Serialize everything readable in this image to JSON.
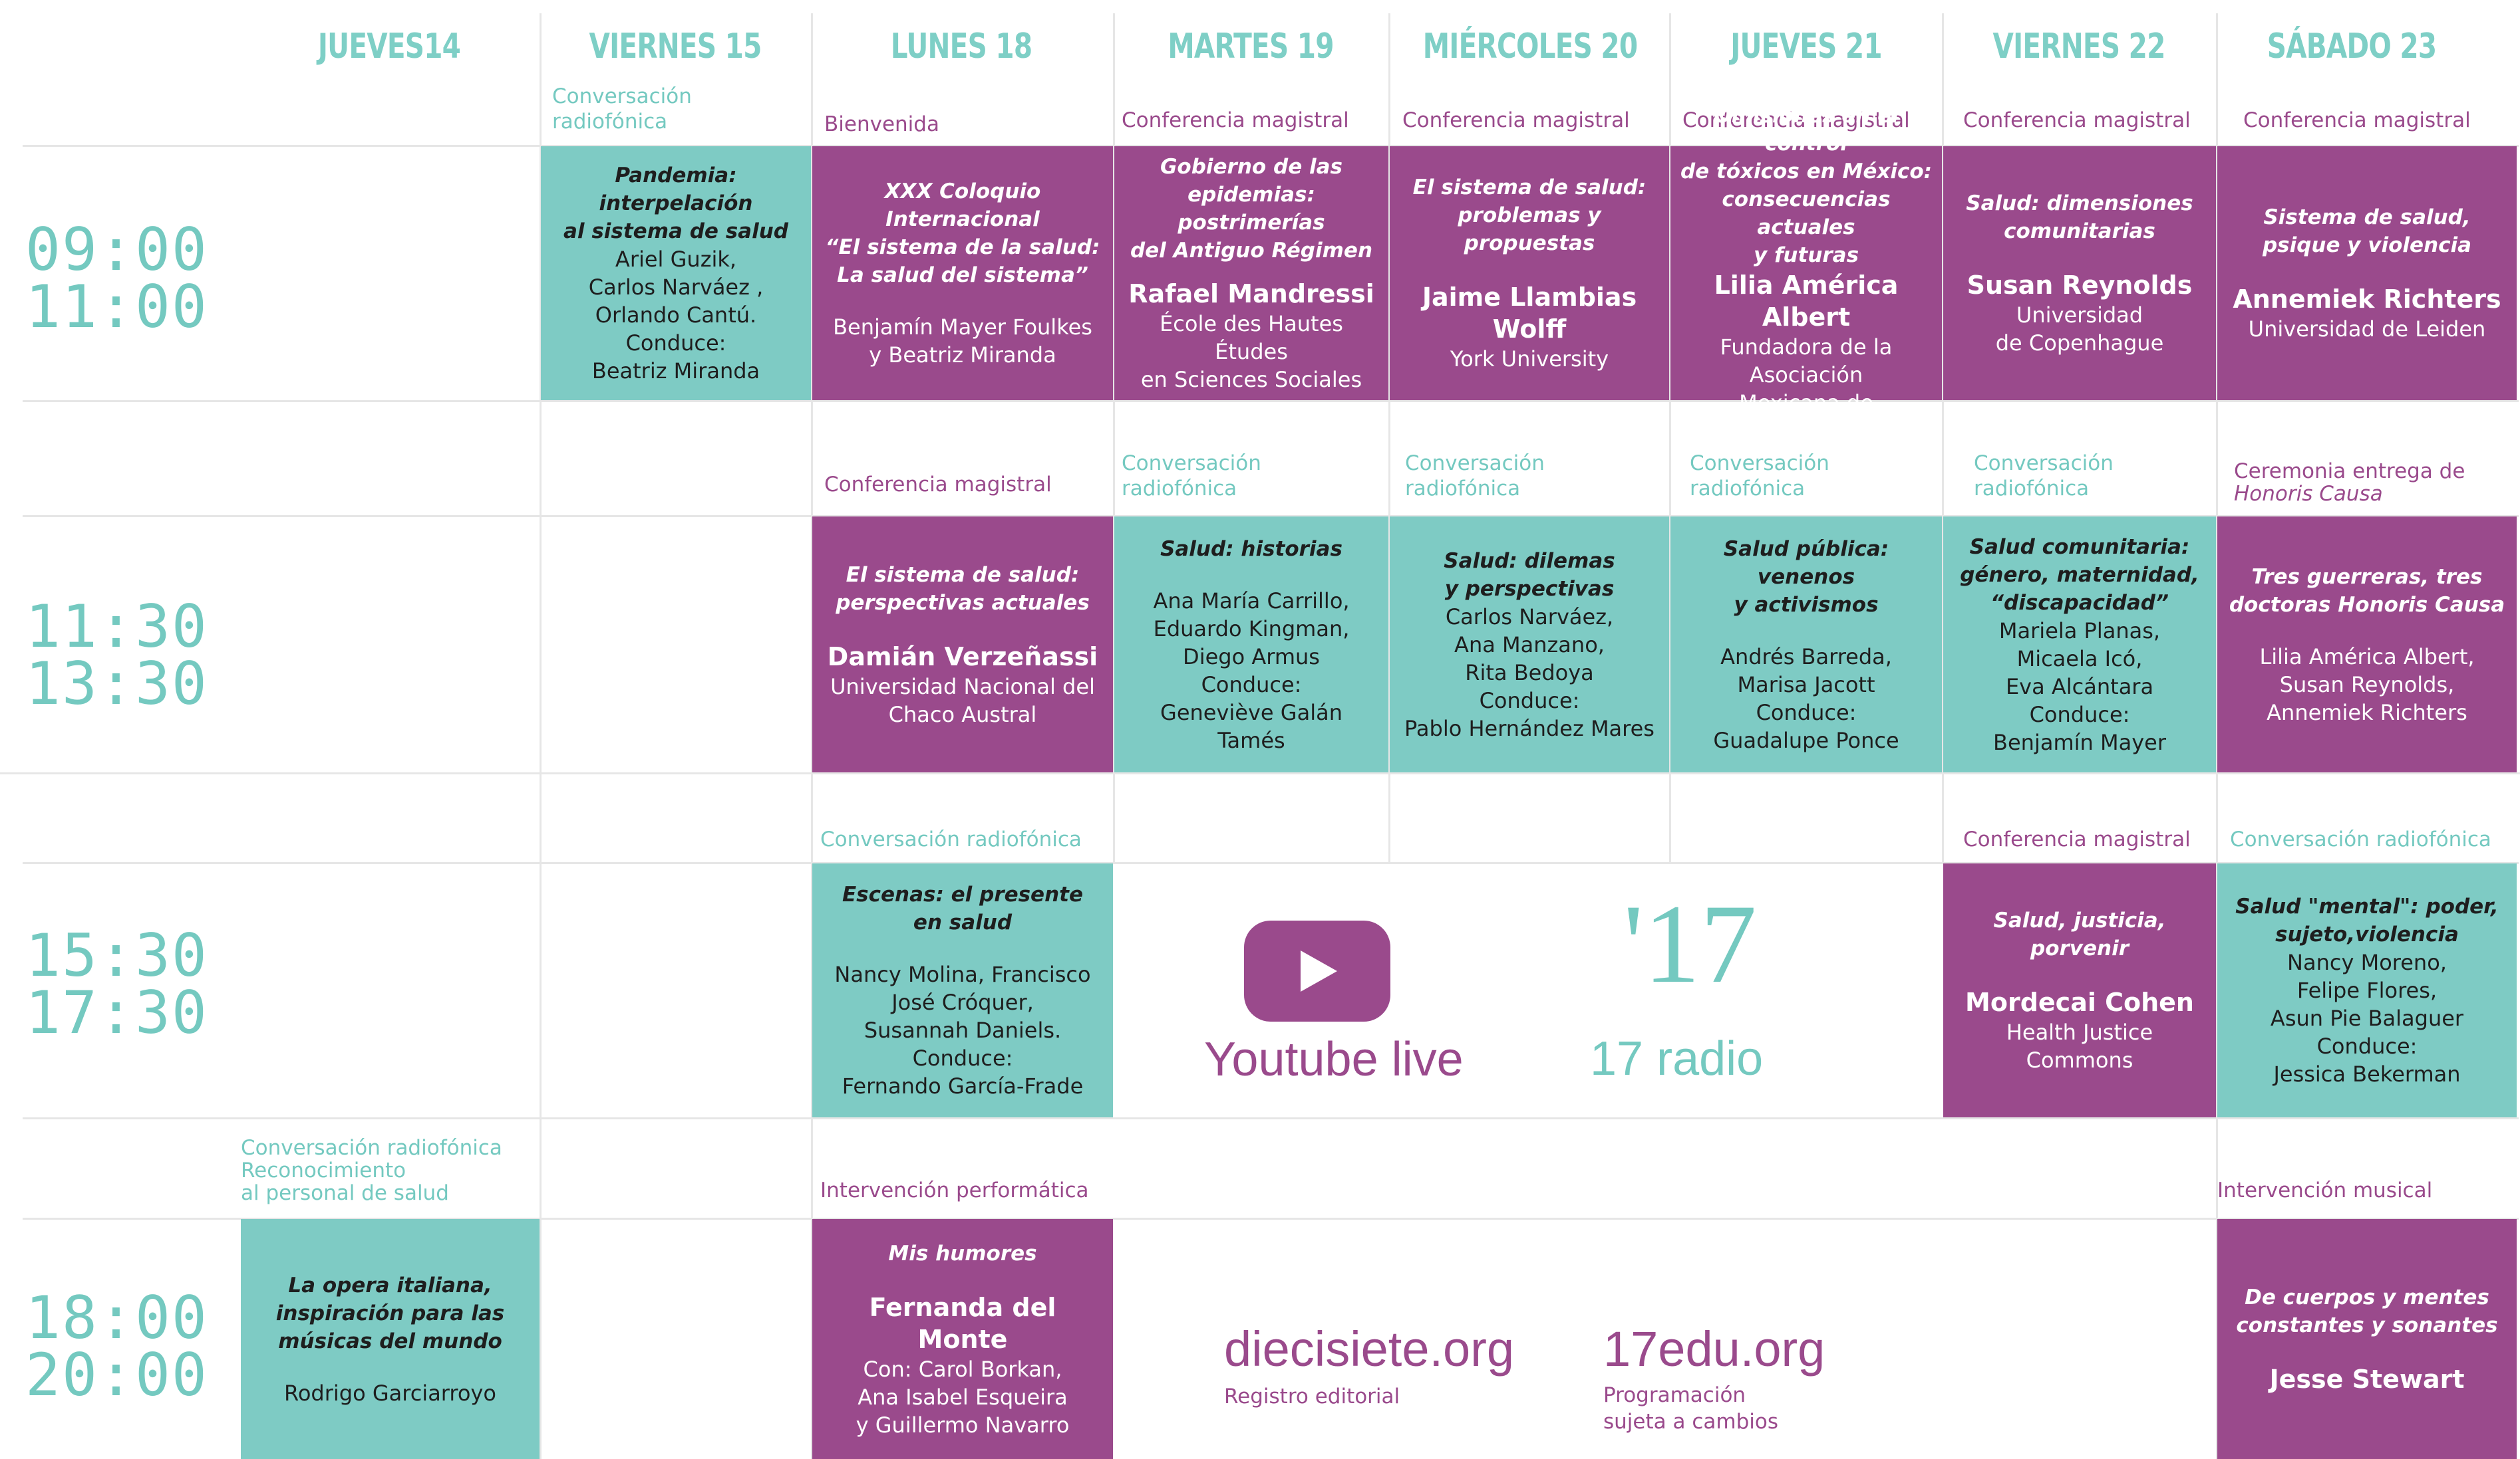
{
  "days": [
    "JUEVES14",
    "VIERNES 15",
    "LUNES 18",
    "MARTES 19",
    "MIÉRCOLES 20",
    "JUEVES 21",
    "VIERNES 22",
    "SÁBADO 23"
  ],
  "times": [
    {
      "start": "09:00",
      "end": "11:00"
    },
    {
      "start": "11:30",
      "end": "13:30"
    },
    {
      "start": "15:30",
      "end": "17:30"
    },
    {
      "start": "18:00",
      "end": "20:00"
    }
  ],
  "slot_labels": {
    "r1": {
      "viernes15": "Conversación\nradiofónica",
      "lunes18": "Bienvenida",
      "martes19": "Conferencia magistral",
      "miercoles20": "Conferencia magistral",
      "jueves21": "Conferencia magistral",
      "viernes22": "Conferencia magistral",
      "sabado23": "Conferencia magistral"
    },
    "r2": {
      "lunes18": "Conferencia magistral",
      "martes19": "Conversación\nradiofónica",
      "miercoles20": "Conversación\nradiofónica",
      "jueves21": "Conversación\nradiofónica",
      "viernes22": "Conversación\nradiofónica",
      "sabado23_line1": "Ceremonia entrega de",
      "sabado23_line2": "Honoris Causa"
    },
    "r3": {
      "lunes18": "Conversación radiofónica",
      "viernes22": "Conferencia magistral",
      "sabado23": "Conversación radiofónica"
    },
    "r4": {
      "jueves14_line1": "Conversación radiofónica",
      "jueves14_line2": "Reconocimiento",
      "jueves14_line3": "al personal de salud",
      "lunes18": "Intervención performática",
      "sabado23": "Intervención musical"
    }
  },
  "sessions": {
    "r1_viernes15": {
      "title": "Pandemia:\ninterpelación\nal sistema de salud",
      "body": "Ariel Guzik,\nCarlos Narváez ,\nOrlando Cantú.\nConduce:\nBeatriz Miranda"
    },
    "r1_lunes18": {
      "title": "XXX Coloquio\nInternacional\n“El sistema de la salud:\nLa salud del sistema”",
      "body": "Benjamín Mayer Foulkes\ny Beatriz Miranda"
    },
    "r1_martes19": {
      "title": "Gobierno de las epidemias:\npostrimerías\ndel Antiguo Régimen",
      "speaker": "Rafael Mandressi",
      "body": "École des Hautes Études\nen Sciences Sociales"
    },
    "r1_miercoles20": {
      "title": "El sistema de salud:\nproblemas y propuestas",
      "speaker": "Jaime Llambias\nWolff",
      "body": "York University"
    },
    "r1_jueves21": {
      "title": "Omisiones en el control\nde tóxicos en México:\nconsecuencias actuales\ny futuras",
      "speaker": "Lilia América Albert",
      "body": "Fundadora de la Asociación\nMexicana de Toxicología"
    },
    "r1_viernes22": {
      "title": "Salud: dimensiones\ncomunitarias",
      "speaker": "Susan Reynolds",
      "body": "Universidad\nde Copenhague"
    },
    "r1_sabado23": {
      "title": "Sistema de salud,\npsique y violencia",
      "speaker": "Annemiek Richters",
      "body": "Universidad de Leiden"
    },
    "r2_lunes18": {
      "title": "El sistema de salud:\nperspectivas actuales",
      "speaker": "Damián Verzeñassi",
      "body": "Universidad Nacional del\nChaco Austral"
    },
    "r2_martes19": {
      "title": "Salud: historias",
      "body": "Ana María Carrillo,\nEduardo Kingman,\nDiego Armus\nConduce:\nGeneviève Galán Tamés"
    },
    "r2_miercoles20": {
      "title": "Salud: dilemas\ny perspectivas",
      "body": "Carlos Narváez,\nAna Manzano,\nRita Bedoya\nConduce:\nPablo Hernández Mares"
    },
    "r2_jueves21": {
      "title": "Salud pública: venenos\ny activismos",
      "body": "Andrés Barreda,\nMarisa Jacott\nConduce:\nGuadalupe Ponce"
    },
    "r2_viernes22": {
      "title": "Salud comunitaria:\ngénero, maternidad,\n“discapacidad”",
      "body": "Mariela Planas,\nMicaela Icó,\nEva Alcántara\nConduce:\nBenjamín Mayer"
    },
    "r2_sabado23": {
      "title": "Tres guerreras, tres\ndoctoras Honoris Causa",
      "body": "Lilia América Albert,\nSusan Reynolds,\nAnnemiek Richters"
    },
    "r3_lunes18": {
      "title": "Escenas: el presente\nen salud",
      "body": "Nancy Molina, Francisco\nJosé Cróquer,\nSusannah Daniels.\nConduce:\nFernando García-Frade"
    },
    "r3_viernes22": {
      "title": "Salud, justicia, porvenir",
      "speaker": "Mordecai Cohen",
      "body": "Health Justice Commons"
    },
    "r3_sabado23": {
      "title": "Salud \"mental\": poder,\nsujeto,violencia",
      "body": "Nancy Moreno,\nFelipe Flores,\nAsun Pie Balaguer\nConduce:\nJessica Bekerman"
    },
    "r4_jueves14": {
      "title": "La opera italiana,\ninspiración para las\nmúsicas del mundo",
      "body": "Rodrigo Garciarroyo"
    },
    "r4_lunes18": {
      "title": "Mis humores",
      "speaker": "Fernanda del Monte",
      "body": "Con: Carol Borkan,\nAna Isabel Esqueira\ny  Guillermo Navarro"
    },
    "r4_sabado23": {
      "title": "De cuerpos y mentes\nconstantes y sonantes",
      "speaker": "Jesse Stewart"
    }
  },
  "promos": {
    "youtube_label": "Youtube live",
    "youtube_icon": "play-button-icon",
    "radio_logo": "'17",
    "radio_label": "17 radio",
    "site1": "diecisiete.org",
    "site1_caption": "Registro editorial",
    "site2": "17edu.org",
    "site2_caption_line1": "Programación",
    "site2_caption_line2": "sujeta a cambios"
  },
  "colors": {
    "purple": "#9a4a8c",
    "teal": "#7ecbc4",
    "teal_text": "#74c9c0",
    "grid": "#e6e6e6"
  }
}
